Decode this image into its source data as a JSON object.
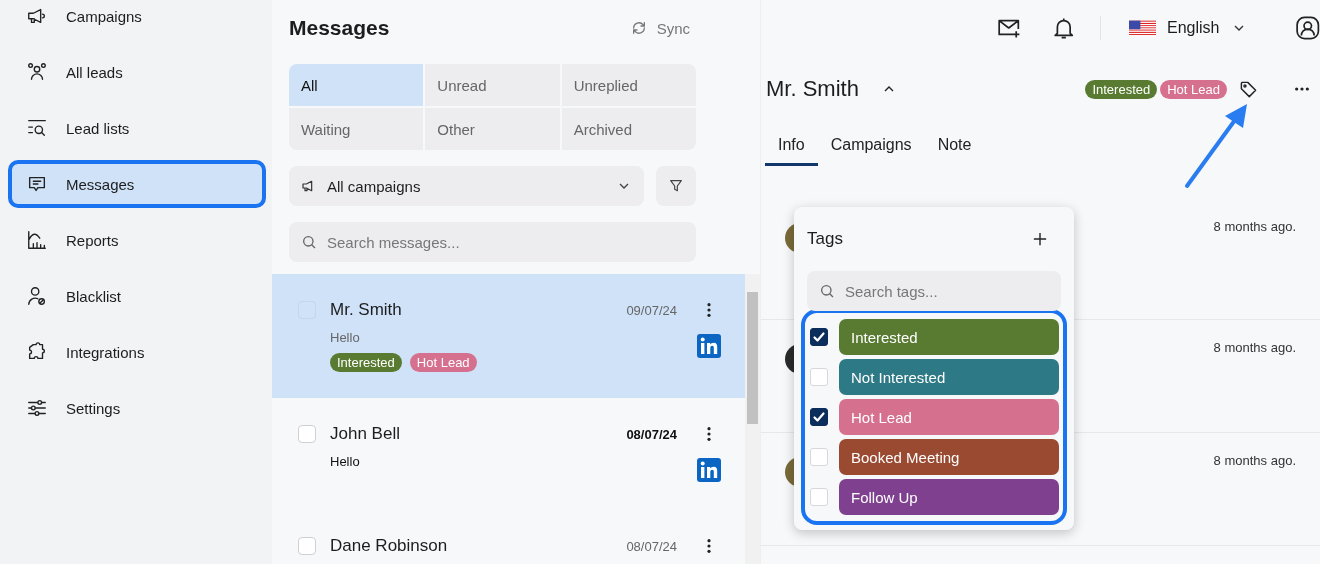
{
  "sidebar": {
    "items": [
      {
        "label": "Campaigns",
        "selected": false
      },
      {
        "label": "All leads",
        "selected": false
      },
      {
        "label": "Lead lists",
        "selected": false
      },
      {
        "label": "Messages",
        "selected": true
      },
      {
        "label": "Reports",
        "selected": false
      },
      {
        "label": "Blacklist",
        "selected": false
      },
      {
        "label": "Integrations",
        "selected": false
      },
      {
        "label": "Settings",
        "selected": false
      }
    ]
  },
  "messages_panel": {
    "title": "Messages",
    "sync_label": "Sync",
    "filters": [
      {
        "label": "All",
        "selected": true
      },
      {
        "label": "Unread",
        "selected": false
      },
      {
        "label": "Unreplied",
        "selected": false
      },
      {
        "label": "Waiting",
        "selected": false
      },
      {
        "label": "Other",
        "selected": false
      },
      {
        "label": "Archived",
        "selected": false
      }
    ],
    "campaign_select": {
      "value": "All campaigns"
    },
    "search": {
      "placeholder": "Search messages..."
    },
    "conversations": [
      {
        "name": "Mr. Smith",
        "date": "09/07/24",
        "preview": "Hello",
        "kind": "linkedin",
        "selected": true,
        "checked": false,
        "unread": false,
        "tags": [
          {
            "label": "Interested",
            "color": "#587b31"
          },
          {
            "label": "Hot Lead",
            "color": "#d6708f"
          }
        ]
      },
      {
        "name": "John Bell",
        "date": "08/07/24",
        "preview": "Hello",
        "kind": "linkedin",
        "selected": false,
        "checked": false,
        "unread": true
      },
      {
        "name": "Dane Robinson",
        "date": "08/07/24",
        "selected": false,
        "checked": false,
        "unread": false
      }
    ]
  },
  "top_bar": {
    "language": "English"
  },
  "lead": {
    "name": "Mr. Smith",
    "tags": [
      {
        "label": "Interested",
        "color": "#587b31"
      },
      {
        "label": "Hot Lead",
        "color": "#d6708f"
      }
    ],
    "tabs": [
      {
        "label": "Info",
        "selected": true
      },
      {
        "label": "Campaigns",
        "selected": false
      },
      {
        "label": "Note",
        "selected": false
      }
    ],
    "activity": [
      {
        "time": "8 months ago.",
        "color": "#7a6a3a"
      },
      {
        "time": "8 months ago.",
        "color": "#2b2b2b"
      },
      {
        "time": "8 months ago.",
        "color": "#7a6a3a"
      }
    ]
  },
  "tags_popup": {
    "title": "Tags",
    "search": {
      "placeholder": "Search tags..."
    },
    "tags": [
      {
        "label": "Interested",
        "color": "#587b31",
        "checked": true
      },
      {
        "label": "Not Interested",
        "color": "#2e7986",
        "checked": false
      },
      {
        "label": "Hot Lead",
        "color": "#d6708f",
        "checked": true
      },
      {
        "label": "Booked Meeting",
        "color": "#9a4a30",
        "checked": false
      },
      {
        "label": "Follow Up",
        "color": "#7f418f",
        "checked": false
      }
    ]
  }
}
